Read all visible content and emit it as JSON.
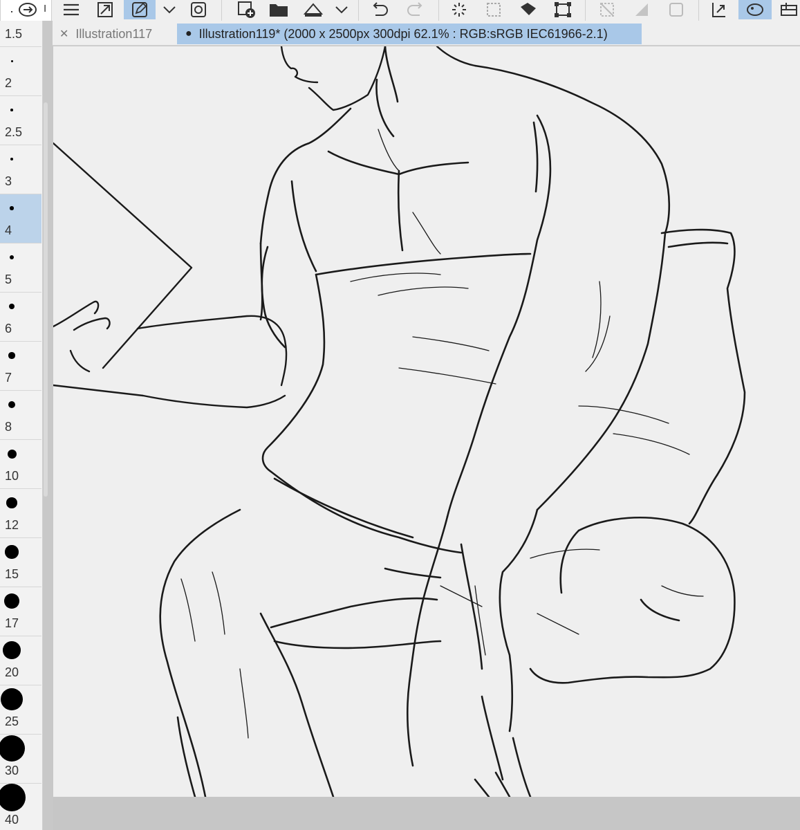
{
  "toolbar": {
    "icons": [
      "menu-icon",
      "resize-icon",
      "edit-icon",
      "chevron-down-icon",
      "layers-icon",
      "new-file-icon",
      "open-folder-icon",
      "save-icon",
      "chevron-down-icon",
      "undo-icon",
      "redo-icon",
      "loading-icon",
      "selection-icon",
      "fill-icon",
      "transform-icon",
      "deselect-icon",
      "gradient-icon",
      "frame-icon",
      "transform-layer-icon",
      "palette-icon",
      "panel-icon"
    ],
    "active_color": "#a9c8e8"
  },
  "side_panel": {
    "tab_icon": "link-icon",
    "tab_fragment": "I",
    "sizes": [
      "1.5",
      "2",
      "2.5",
      "3",
      "4",
      "5",
      "6",
      "7",
      "8",
      "10",
      "12",
      "15",
      "17",
      "20",
      "25",
      "30",
      "40"
    ],
    "selected_size": "4",
    "selected_color": "#bcd3ea"
  },
  "document_tabs": [
    {
      "label": "Illustration117",
      "active": false,
      "marker": "close-icon"
    },
    {
      "label": "Illustration119* (2000 x 2500px 300dpi 62.1% : RGB:sRGB IEC61966-2.1)",
      "active": true,
      "marker": "unsaved-dot-icon"
    }
  ],
  "canvas": {
    "background": "#efefef",
    "artwork": "line-drawing-figure-with-pillow"
  }
}
